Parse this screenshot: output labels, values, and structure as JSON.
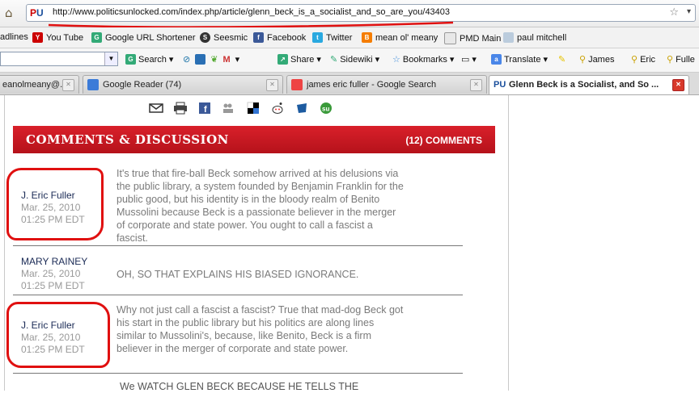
{
  "browser": {
    "url": "http://www.politicsunlocked.com/index.php/article/glenn_beck_is_a_socialist_and_so_are_you/43403",
    "favicon_text": "PU",
    "bookmarks": [
      "adlines",
      "You Tube",
      "Google URL Shortener",
      "Seesmic",
      "Facebook",
      "Twitter",
      "mean ol' meany",
      "PMD Main",
      "paul mitchell"
    ],
    "toolbar": {
      "search_label": "Search",
      "share_label": "Share",
      "sidewiki_label": "Sidewiki",
      "bookmarks_label": "Bookmarks",
      "translate_label": "Translate",
      "profiles": [
        "James",
        "Eric",
        "Fulle"
      ]
    },
    "tabs": [
      {
        "label": "eanolmeany@..."
      },
      {
        "label": "Google Reader (74)"
      },
      {
        "label": "james eric fuller - Google Search"
      },
      {
        "label": "Glenn Beck is a Socialist, and So ..."
      }
    ]
  },
  "colors": {
    "accent_red": "#c8151f",
    "annotation_red": "#e01010"
  },
  "discussion": {
    "title": "COMMENTS & DISCUSSION",
    "count": "(12) COMMENTS"
  },
  "comments": [
    {
      "name": "J. Eric Fuller",
      "date": "Mar. 25, 2010",
      "time": "01:25 PM EDT",
      "text": "It's true that fire-ball Beck somehow arrived at his delusions via the public library, a system founded by Benjamin Franklin for the public good, but his identity is in the bloody realm of Benito Mussolini because Beck is a passionate believer in the merger of corporate and state power. You ought to call a fascist a fascist."
    },
    {
      "name": "MARY RAINEY",
      "date": "Mar. 25, 2010",
      "time": "01:25 PM EDT",
      "text": "OH, SO THAT EXPLAINS HIS BIASED IGNORANCE."
    },
    {
      "name": "J. Eric Fuller",
      "date": "Mar. 25, 2010",
      "time": "01:25 PM EDT",
      "text": "Why not just call a fascist a fascist? True that mad-dog Beck got his start in the public library but his politics are along lines similar to Mussolini's, because, like Benito, Beck is a firm believer in the merger of corporate and state power."
    },
    {
      "text": "We WATCH GLEN BECK BECAUSE HE TELLS THE"
    }
  ]
}
